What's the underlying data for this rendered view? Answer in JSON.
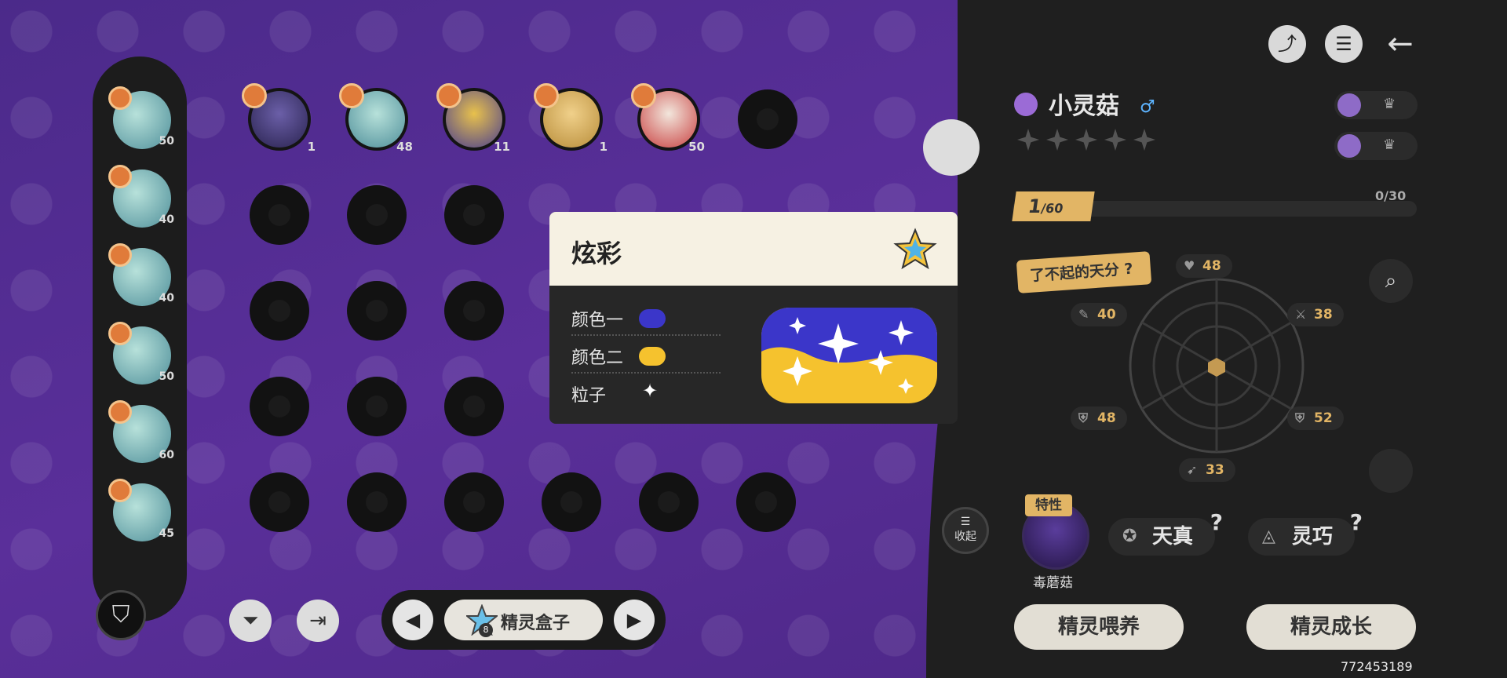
{
  "left_list": {
    "levels": [
      "50",
      "40",
      "40",
      "50",
      "60",
      "45"
    ]
  },
  "grid": {
    "top_row_levels": [
      "1",
      "48",
      "11",
      "1",
      "50"
    ]
  },
  "toolbar": {
    "filter_icon": "filter-icon",
    "exit_icon": "exit-door-icon",
    "box_label": "精灵盒子",
    "box_count": "8",
    "prev_icon": "◀",
    "next_icon": "▶"
  },
  "popup": {
    "title": "炫彩",
    "rows": [
      {
        "label": "颜色一",
        "color": "#3b36c9"
      },
      {
        "label": "颜色二",
        "color": "#f5c22e"
      },
      {
        "label": "粒子",
        "particle": "✦"
      }
    ]
  },
  "header": {
    "share_icon": "share-icon",
    "list_icon": "list-icon",
    "back_icon": "back-arrow-icon"
  },
  "pet": {
    "name": "小灵菇",
    "gender": "♂",
    "level": "1",
    "level_max": "/60",
    "xp": "0/30",
    "talent_label": "了不起的天分",
    "stats": {
      "hp": "48",
      "atk_left": "40",
      "atk_right": "38",
      "def_left": "48",
      "def_right": "52",
      "speed": "33"
    },
    "trait_tag": "特性",
    "trait_name": "毒蘑菇",
    "nature_1": "天真",
    "nature_2": "灵巧",
    "collapse_label": "收起"
  },
  "actions": {
    "feed": "精灵喂养",
    "grow": "精灵成长"
  },
  "uid": "772453189",
  "colors": {
    "accent_gold": "#e2b565",
    "bg_purple": "#5a2f9a",
    "panel_dark": "#1f1f1f"
  }
}
